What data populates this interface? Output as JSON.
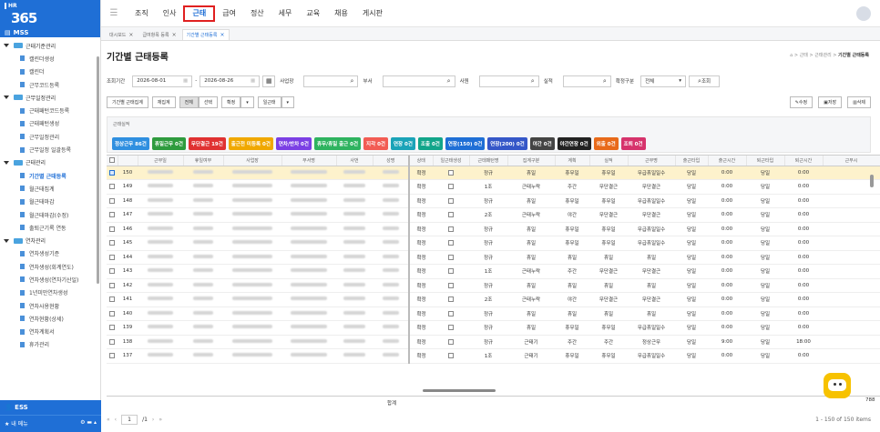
{
  "logo": {
    "hr": "HR",
    "num": "365"
  },
  "sidebar": {
    "section": "MSS",
    "items": [
      {
        "label": "근태기준관리",
        "type": "grp"
      },
      {
        "label": "캘린더생성",
        "type": "sub"
      },
      {
        "label": "캘린더",
        "type": "sub"
      },
      {
        "label": "근무코드등록",
        "type": "sub"
      },
      {
        "label": "근무일정관리",
        "type": "grp"
      },
      {
        "label": "근태패턴코드등록",
        "type": "sub"
      },
      {
        "label": "근태패턴생성",
        "type": "sub"
      },
      {
        "label": "근무일정관리",
        "type": "sub"
      },
      {
        "label": "근무일정 일괄등록",
        "type": "sub"
      },
      {
        "label": "근태관리",
        "type": "grp"
      },
      {
        "label": "기간별 근태등록",
        "type": "sub",
        "active": true
      },
      {
        "label": "월근태집계",
        "type": "sub"
      },
      {
        "label": "월근태마감",
        "type": "sub"
      },
      {
        "label": "월근태마감(수정)",
        "type": "sub"
      },
      {
        "label": "출퇴근기록 연동",
        "type": "sub"
      },
      {
        "label": "연차관리",
        "type": "grp"
      },
      {
        "label": "연차생성기준",
        "type": "sub"
      },
      {
        "label": "연차생성(회계연도)",
        "type": "sub"
      },
      {
        "label": "연차생성(연차기산일)",
        "type": "sub"
      },
      {
        "label": "1년미만연차생성",
        "type": "sub"
      },
      {
        "label": "연차사용현황",
        "type": "sub"
      },
      {
        "label": "연차현황(상세)",
        "type": "sub"
      },
      {
        "label": "연차계획서",
        "type": "sub"
      },
      {
        "label": "휴가관리",
        "type": "sub"
      }
    ],
    "ess": "ESS",
    "mymenu": "내 메뉴"
  },
  "topnav": {
    "items": [
      "조직",
      "인사",
      "근태",
      "급여",
      "정산",
      "세무",
      "교육",
      "채용",
      "게시판"
    ],
    "active": "근태"
  },
  "tabs": [
    {
      "label": "대시보드",
      "active": false
    },
    {
      "label": "급여항목 등록",
      "active": false
    },
    {
      "label": "기간별 근태등록",
      "active": true
    }
  ],
  "page": {
    "title": "기간별 근태등록",
    "breadcrumb": "⌂ > 근태 > 근태관리 > ",
    "breadcrumb_current": "기간별 근태등록"
  },
  "filters": {
    "period_label": "조회기간",
    "date_from": "2026-08-01",
    "date_to": "2026-08-26",
    "dash": "-",
    "site_label": "사업장",
    "dept_label": "부서",
    "emp_label": "사원",
    "actual_label": "실적",
    "confirm_label": "확정구분",
    "confirm_value": "전체",
    "search_btn": "조회"
  },
  "toolbar": {
    "btn_period": "기간별 근태집계",
    "btn_recalc": "재집계",
    "btn_all": "전체",
    "btn_select": "선택",
    "btn_confirm": "확정",
    "btn_daily": "일근태",
    "btn_edit": "수정",
    "btn_save": "저장",
    "btn_delete": "삭제"
  },
  "summary": {
    "label": "근태실적",
    "badges": [
      {
        "label": "정상근무 86건",
        "color": "#2f8fe0"
      },
      {
        "label": "휴일근무 0건",
        "color": "#2e9b3e"
      },
      {
        "label": "무단결근 19건",
        "color": "#e03131"
      },
      {
        "label": "출근전 미등록 0건",
        "color": "#f0a800"
      },
      {
        "label": "연차/반차 0건",
        "color": "#7b3fe4"
      },
      {
        "label": "휴무/휴일 출근 0건",
        "color": "#2eb35f"
      },
      {
        "label": "지각 0건",
        "color": "#f25c54"
      },
      {
        "label": "연장 0건",
        "color": "#1aa3b8"
      },
      {
        "label": "조출 0건",
        "color": "#12a58a"
      },
      {
        "label": "연장(150) 0건",
        "color": "#1f6fd6"
      },
      {
        "label": "연장(200) 0건",
        "color": "#3557c8"
      },
      {
        "label": "야간 0건",
        "color": "#444444"
      },
      {
        "label": "야간연장 0건",
        "color": "#222222"
      },
      {
        "label": "외출 0건",
        "color": "#e86a1a"
      },
      {
        "label": "조퇴 0건",
        "color": "#d6336c"
      }
    ]
  },
  "grid": {
    "headers": [
      "",
      "",
      "근무일",
      "휴일여부",
      "사업장",
      "부서명",
      "사번",
      "성명",
      "상태",
      "일근태생성",
      "근태패턴명",
      "집계구분",
      "계획",
      "실적",
      "근무명",
      "출근타입",
      "출근시간",
      "퇴근타입",
      "퇴근시간",
      "근무시"
    ],
    "rows": [
      {
        "no": "150",
        "sel": true,
        "status": "확정",
        "pattern": "정규",
        "agg": "휴일",
        "plan": "휴무일",
        "actual": "휴무일",
        "work": "무급휴일일수",
        "in_type": "당일",
        "in_time": "0:00",
        "out_type": "당일",
        "out_time": "0:00"
      },
      {
        "no": "149",
        "status": "확정",
        "pattern": "1조",
        "agg": "근태누락",
        "plan": "주간",
        "actual": "무단결근",
        "work": "무단결근",
        "in_type": "당일",
        "in_time": "0:00",
        "out_type": "당일",
        "out_time": "0:00"
      },
      {
        "no": "148",
        "status": "확정",
        "pattern": "정규",
        "agg": "휴일",
        "plan": "휴무일",
        "actual": "휴무일",
        "work": "무급휴일일수",
        "in_type": "당일",
        "in_time": "0:00",
        "out_type": "당일",
        "out_time": "0:00"
      },
      {
        "no": "147",
        "status": "확정",
        "pattern": "2조",
        "agg": "근태누락",
        "plan": "야간",
        "actual": "무단결근",
        "work": "무단결근",
        "in_type": "당일",
        "in_time": "0:00",
        "out_type": "당일",
        "out_time": "0:00"
      },
      {
        "no": "146",
        "status": "확정",
        "pattern": "정규",
        "agg": "휴일",
        "plan": "휴무일",
        "actual": "휴무일",
        "work": "무급휴일일수",
        "in_type": "당일",
        "in_time": "0:00",
        "out_type": "당일",
        "out_time": "0:00"
      },
      {
        "no": "145",
        "status": "확정",
        "pattern": "정규",
        "agg": "휴일",
        "plan": "휴무일",
        "actual": "휴무일",
        "work": "무급휴일일수",
        "in_type": "당일",
        "in_time": "0:00",
        "out_type": "당일",
        "out_time": "0:00"
      },
      {
        "no": "144",
        "status": "확정",
        "pattern": "정규",
        "agg": "휴일",
        "plan": "휴일",
        "actual": "휴일",
        "work": "휴일",
        "in_type": "당일",
        "in_time": "0:00",
        "out_type": "당일",
        "out_time": "0:00"
      },
      {
        "no": "143",
        "status": "확정",
        "pattern": "1조",
        "agg": "근태누락",
        "plan": "주간",
        "actual": "무단결근",
        "work": "무단결근",
        "in_type": "당일",
        "in_time": "0:00",
        "out_type": "당일",
        "out_time": "0:00"
      },
      {
        "no": "142",
        "status": "확정",
        "pattern": "정규",
        "agg": "휴일",
        "plan": "휴일",
        "actual": "휴일",
        "work": "휴일",
        "in_type": "당일",
        "in_time": "0:00",
        "out_type": "당일",
        "out_time": "0:00"
      },
      {
        "no": "141",
        "status": "확정",
        "pattern": "2조",
        "agg": "근태누락",
        "plan": "야간",
        "actual": "무단결근",
        "work": "무단결근",
        "in_type": "당일",
        "in_time": "0:00",
        "out_type": "당일",
        "out_time": "0:00"
      },
      {
        "no": "140",
        "status": "확정",
        "pattern": "정규",
        "agg": "휴일",
        "plan": "휴일",
        "actual": "휴일",
        "work": "휴일",
        "in_type": "당일",
        "in_time": "0:00",
        "out_type": "당일",
        "out_time": "0:00"
      },
      {
        "no": "139",
        "status": "확정",
        "pattern": "정규",
        "agg": "휴일",
        "plan": "휴무일",
        "actual": "휴무일",
        "work": "무급휴일일수",
        "in_type": "당일",
        "in_time": "0:00",
        "out_type": "당일",
        "out_time": "0:00"
      },
      {
        "no": "138",
        "status": "확정",
        "pattern": "정규",
        "agg": "근태기",
        "plan": "주간",
        "actual": "주간",
        "work": "정상근무",
        "in_type": "당일",
        "in_time": "9:00",
        "out_type": "당일",
        "out_time": "18:00"
      },
      {
        "no": "137",
        "status": "확정",
        "pattern": "1조",
        "agg": "근태기",
        "plan": "휴무일",
        "actual": "휴무일",
        "work": "무급휴일일수",
        "in_type": "당일",
        "in_time": "0:00",
        "out_type": "당일",
        "out_time": "0:00"
      }
    ],
    "total_label": "합계",
    "total_right": "788"
  },
  "pager": {
    "first": "«",
    "prev": "‹",
    "page": "1",
    "of": "/1",
    "next": "›",
    "last": "»",
    "info": "1 - 150 of 150 items"
  }
}
